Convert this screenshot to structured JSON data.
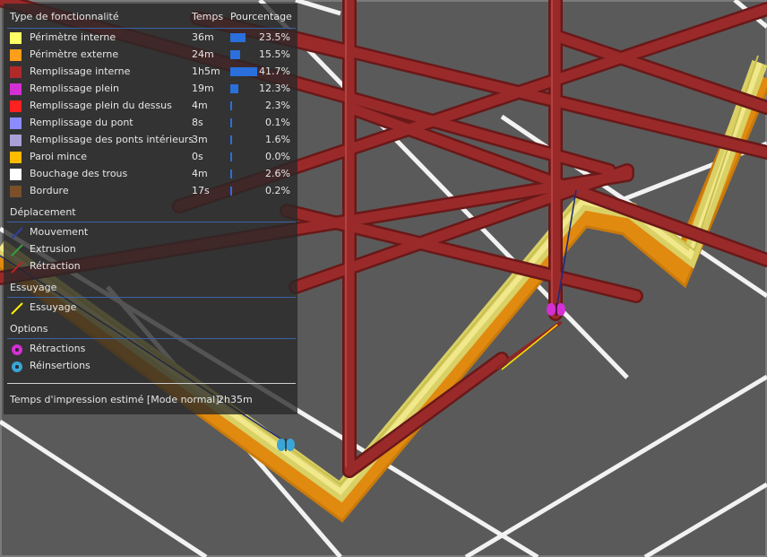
{
  "legend": {
    "header": {
      "type": "Type de fonctionnalité",
      "time": "Temps",
      "percent": "Pourcentage"
    },
    "features": [
      {
        "label": "Périmètre interne",
        "time": "36m",
        "percent": "23.5%",
        "value": 23.5,
        "color": "#ffff66"
      },
      {
        "label": "Périmètre externe",
        "time": "24m",
        "percent": "15.5%",
        "value": 15.5,
        "color": "#ff9e1a"
      },
      {
        "label": "Remplissage interne",
        "time": "1h5m",
        "percent": "41.7%",
        "value": 41.7,
        "color": "#b02a2a"
      },
      {
        "label": "Remplissage plein",
        "time": "19m",
        "percent": "12.3%",
        "value": 12.3,
        "color": "#d42fd4"
      },
      {
        "label": "Remplissage plein du dessus",
        "time": "4m",
        "percent": "2.3%",
        "value": 2.3,
        "color": "#ff2020"
      },
      {
        "label": "Remplissage du pont",
        "time": "8s",
        "percent": "0.1%",
        "value": 0.1,
        "color": "#8c8cff"
      },
      {
        "label": "Remplissage des ponts intérieurs",
        "time": "3m",
        "percent": "1.6%",
        "value": 1.6,
        "color": "#a9a0d6"
      },
      {
        "label": "Paroi mince",
        "time": "0s",
        "percent": "0.0%",
        "value": 0.0,
        "color": "#ffbb00"
      },
      {
        "label": "Bouchage des trous",
        "time": "4m",
        "percent": "2.6%",
        "value": 2.6,
        "color": "#ffffff"
      },
      {
        "label": "Bordure",
        "time": "17s",
        "percent": "0.2%",
        "value": 0.2,
        "color": "#7a4f2a"
      }
    ],
    "travel": {
      "title": "Déplacement",
      "items": [
        {
          "label": "Mouvement",
          "color": "#3040a0",
          "icon": "travel-line-icon"
        },
        {
          "label": "Extrusion",
          "color": "#30a040",
          "icon": "extrude-line-icon"
        },
        {
          "label": "Rétraction",
          "color": "#c02020",
          "icon": "retract-line-icon"
        }
      ]
    },
    "wipe": {
      "title": "Essuyage",
      "items": [
        {
          "label": "Essuyage",
          "color": "#ffee00",
          "icon": "wipe-line-icon"
        }
      ]
    },
    "options": {
      "title": "Options",
      "items": [
        {
          "label": "Rétractions",
          "color": "#d42fd4",
          "icon": "retraction-dot-icon"
        },
        {
          "label": "Réinsertions",
          "color": "#3aa5d6",
          "icon": "deretraction-dot-icon"
        }
      ]
    },
    "estimate": {
      "label": "Temps d'impression estimé [Mode normal]:",
      "value": "2h35m"
    }
  },
  "scene": {
    "background": "#5a5a5a",
    "grid_color": "#f4f4f4",
    "infill_color": "#8e2525",
    "outer_perimeter_color": "#e08a10",
    "inner_perimeter_color": "#e8e070"
  }
}
